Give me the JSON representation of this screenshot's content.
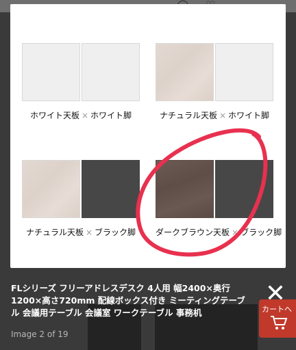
{
  "options": [
    {
      "top": "white",
      "legs": "white",
      "top_label": "ホワイト天板",
      "sep": "×",
      "legs_label": "ホワイト脚"
    },
    {
      "top": "natural",
      "legs": "white",
      "top_label": "ナチュラル天板",
      "sep": "×",
      "legs_label": "ホワイト脚"
    },
    {
      "top": "natural",
      "legs": "black",
      "top_label": "ナチュラル天板",
      "sep": "×",
      "legs_label": "ブラック脚"
    },
    {
      "top": "brown",
      "legs": "black",
      "top_label": "ダークブラウン天板",
      "sep": "×",
      "legs_label": "ブラック脚"
    }
  ],
  "annotation_color": "#e8314f",
  "caption": {
    "title": "FLシリーズ フリーアドレスデスク 4人用 幅2400×奥行1200×高さ720mm 配線ボックス付き ミーティングテーブル 会議用テーブル 会議室 ワークテーブル 事務机",
    "image_counter": "Image 2 of 19"
  },
  "close_label": "✕",
  "cart": {
    "label": "カートへ",
    "icon": "cart-icon"
  }
}
